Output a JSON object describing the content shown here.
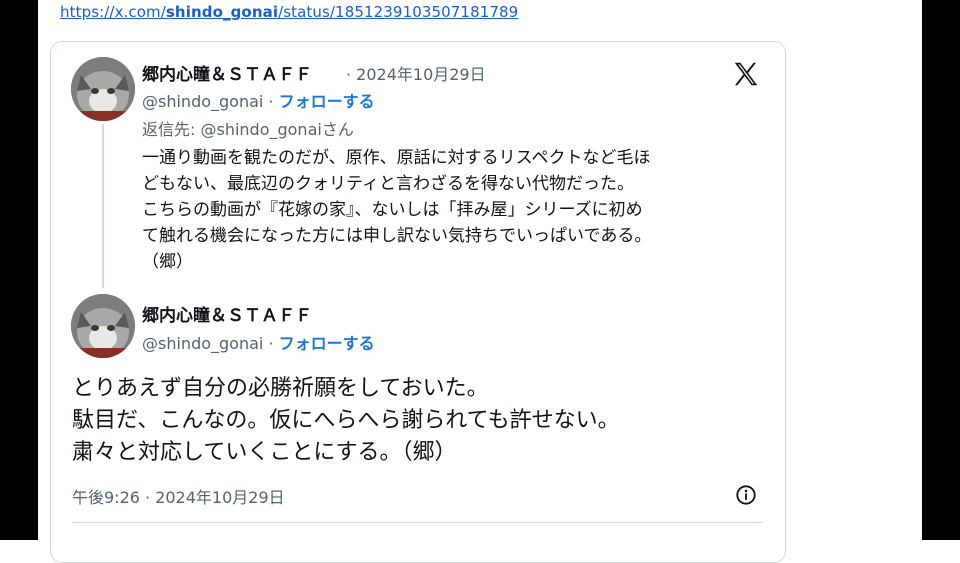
{
  "url": {
    "prefix": "https://x.com/",
    "handle": "shindo_gonai",
    "suffix": "/status/1851239103507181789"
  },
  "quoted_tweet": {
    "author_name": "郷内心瞳＆ＳＴＡＦＦ",
    "date": "2024年10月29日",
    "handle": "@shindo_gonai",
    "follow_label": "フォローする",
    "reply_to": "返信先: @shindo_gonaiさん",
    "body_lines": [
      "一通り動画を観たのだが、原作、原話に対するリスペクトなど毛ほ",
      "どもない、最底辺のクォリティと言わざるを得ない代物だった。",
      "こちらの動画が『花嫁の家』、ないしは「拝み屋」シリーズに初め",
      "て触れる機会になった方には申し訳ない気持ちでいっぱいである。",
      "（郷）"
    ]
  },
  "main_tweet": {
    "author_name": "郷内心瞳＆ＳＴＡＦＦ",
    "handle": "@shindo_gonai",
    "follow_label": "フォローする",
    "body_lines": [
      "とりあえず自分の必勝祈願をしておいた。",
      "駄目だ、こんなの。仮にへらへら謝られても許せない。",
      "粛々と対応していくことにする。（郷）"
    ],
    "timestamp": "午後9:26 · 2024年10月29日"
  },
  "icons": {
    "x_logo": "x-logo-icon",
    "info": "info-icon"
  },
  "colors": {
    "link": "#1a5fc8",
    "follow": "#1d74d6",
    "secondary_text": "#536471",
    "border": "#cfd9de"
  }
}
